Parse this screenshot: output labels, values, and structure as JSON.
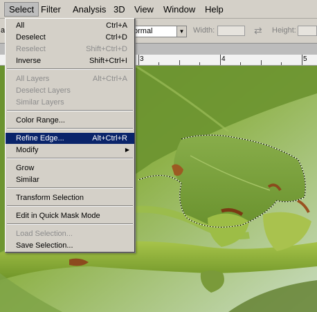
{
  "menubar": {
    "items": [
      {
        "label": "Select"
      },
      {
        "label": "Filter"
      },
      {
        "label": "Analysis"
      },
      {
        "label": "3D"
      },
      {
        "label": "View"
      },
      {
        "label": "Window"
      },
      {
        "label": "Help"
      }
    ]
  },
  "options_bar": {
    "style_value": "ormal",
    "width_label": "Width:",
    "height_label": "Height:",
    "left_fragment": "a"
  },
  "ruler": {
    "numbers": [
      "3",
      "4",
      "5"
    ]
  },
  "select_menu": {
    "items": [
      {
        "label": "All",
        "shortcut": "Ctrl+A",
        "disabled": false
      },
      {
        "label": "Deselect",
        "shortcut": "Ctrl+D",
        "disabled": false
      },
      {
        "label": "Reselect",
        "shortcut": "Shift+Ctrl+D",
        "disabled": true
      },
      {
        "label": "Inverse",
        "shortcut": "Shift+Ctrl+I",
        "disabled": false
      },
      {
        "label": "All Layers",
        "shortcut": "Alt+Ctrl+A",
        "disabled": true
      },
      {
        "label": "Deselect Layers",
        "shortcut": "",
        "disabled": true
      },
      {
        "label": "Similar Layers",
        "shortcut": "",
        "disabled": true
      },
      {
        "label": "Color Range...",
        "shortcut": "",
        "disabled": false
      },
      {
        "label": "Refine Edge...",
        "shortcut": "Alt+Ctrl+R",
        "disabled": false,
        "highlighted": true
      },
      {
        "label": "Modify",
        "shortcut": "",
        "disabled": false,
        "submenu": true
      },
      {
        "label": "Grow",
        "shortcut": "",
        "disabled": false
      },
      {
        "label": "Similar",
        "shortcut": "",
        "disabled": false
      },
      {
        "label": "Transform Selection",
        "shortcut": "",
        "disabled": false
      },
      {
        "label": "Edit in Quick Mask Mode",
        "shortcut": "",
        "disabled": false
      },
      {
        "label": "Load Selection...",
        "shortcut": "",
        "disabled": true
      },
      {
        "label": "Save Selection...",
        "shortcut": "",
        "disabled": false
      }
    ]
  },
  "colors": {
    "menu_bg": "#d4d0c8",
    "highlight": "#0a246a",
    "disabled_text": "#8c8c8c"
  },
  "icons": {
    "swap": "swap-arrows-icon",
    "dropdown": "chevron-down-icon",
    "submenu": "chevron-right-icon"
  }
}
